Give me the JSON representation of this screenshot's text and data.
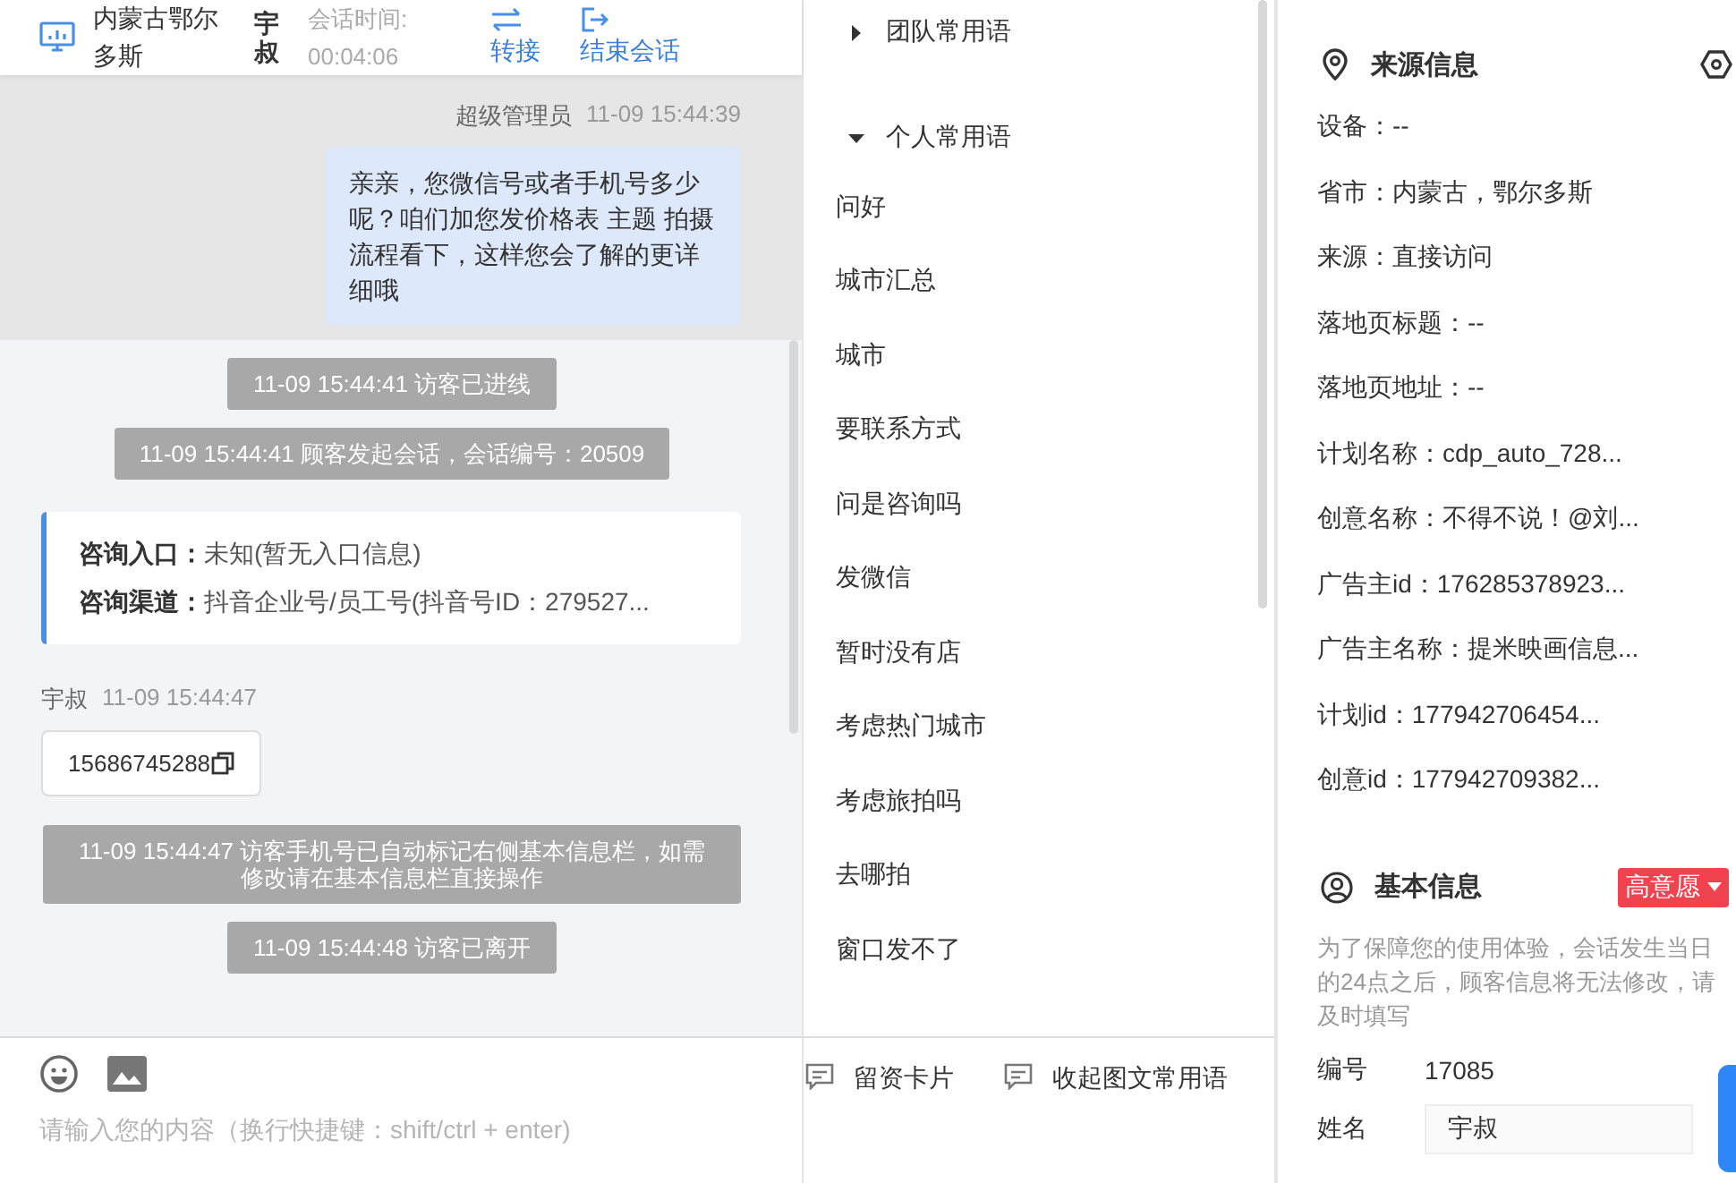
{
  "header": {
    "location": "内蒙古鄂尔多斯",
    "visitor": "宇叔",
    "duration_label": "会话时间:",
    "duration": "00:04:06",
    "actions": [
      {
        "kind": "transfer",
        "label": "转接"
      },
      {
        "kind": "end",
        "label": "结束会话"
      }
    ]
  },
  "messages": [
    {
      "kind": "agent",
      "sender": "超级管理员",
      "time": "11-09 15:44:39",
      "text": "亲亲，您微信号或者手机号多少呢？咱们加您发价格表 主题 拍摄流程看下，这样您会了解的更详细哦",
      "highlighted": true
    },
    {
      "kind": "notice",
      "text": "11-09 15:44:41 访客已进线"
    },
    {
      "kind": "notice",
      "text": "11-09 15:44:41 顾客发起会话，会话编号：20509"
    },
    {
      "kind": "info",
      "rows": [
        {
          "label": "咨询入口：",
          "value": "未知(暂无入口信息)"
        },
        {
          "label": "咨询渠道：",
          "value": "抖音企业号/员工号(抖音号ID：279527..."
        }
      ]
    },
    {
      "kind": "visitor",
      "sender": "宇叔",
      "time": "11-09 15:44:47",
      "text": "15686745288"
    },
    {
      "kind": "notice",
      "text": "11-09 15:44:47 访客手机号已自动标记右侧基本信息栏，如需修改请在基本信息栏直接操作"
    },
    {
      "kind": "notice",
      "text": "11-09 15:44:48 访客已离开"
    }
  ],
  "composer": {
    "placeholder": "请输入您的内容（换行快捷键：shift/ctrl + enter)"
  },
  "phrases": {
    "groups": [
      {
        "title": "团队常用语",
        "expanded": false
      },
      {
        "title": "个人常用语",
        "expanded": true,
        "items": [
          "问好",
          "城市汇总",
          "城市",
          "要联系方式",
          "问是咨询吗",
          "发微信",
          "暂时没有店",
          "考虑热门城市",
          "考虑旅拍吗",
          "去哪拍",
          "窗口发不了"
        ]
      }
    ],
    "buttons": [
      "留资卡片",
      "收起图文常用语"
    ]
  },
  "source_info": {
    "title": "来源信息",
    "items": [
      "设备：--",
      "省市：内蒙古，鄂尔多斯",
      "来源：直接访问",
      "落地页标题：--",
      "落地页地址：--",
      "计划名称：cdp_auto_728...",
      "创意名称：不得不说！@刘...",
      "广告主id：176285378923...",
      "广告主名称：提米映画信息...",
      "计划id：177942706454...",
      "创意id：177942709382..."
    ]
  },
  "basic_info": {
    "title": "基本信息",
    "intent_tag": "高意愿",
    "notice": "为了保障您的使用体验，会话发生当日的24点之后，顾客信息将无法修改，请及时填写",
    "fields": [
      {
        "kind": "text",
        "label": "编号",
        "value": "17085"
      },
      {
        "kind": "input",
        "label": "姓名",
        "value": "宇叔"
      }
    ]
  }
}
